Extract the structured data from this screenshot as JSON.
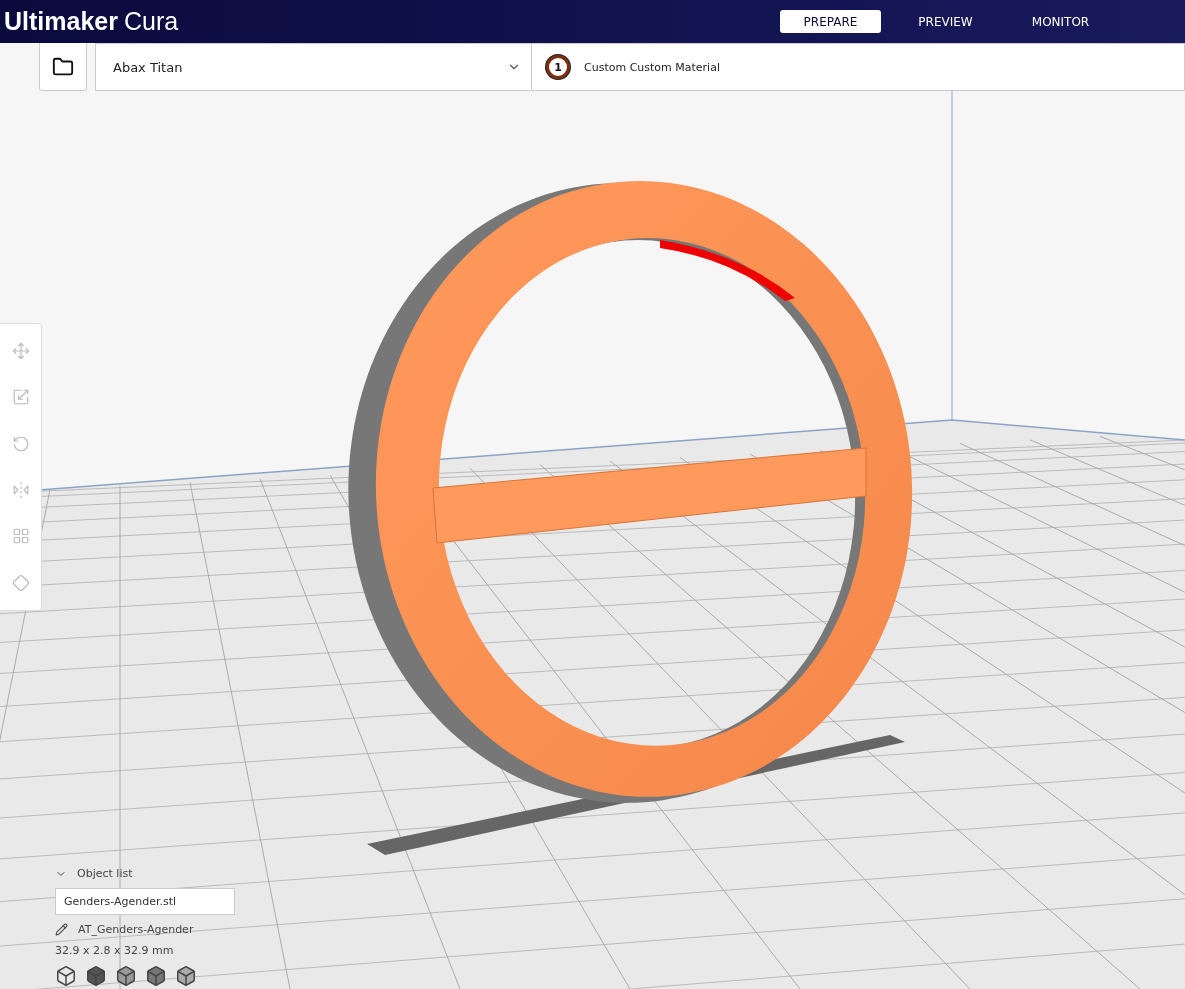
{
  "app": {
    "title_bold": "Ultimaker",
    "title_light": "Cura"
  },
  "stages": [
    {
      "label": "PREPARE",
      "selected": true
    },
    {
      "label": "PREVIEW",
      "selected": false
    },
    {
      "label": "MONITOR",
      "selected": false
    }
  ],
  "printer": {
    "name": "Abax Titan"
  },
  "extruders": [
    {
      "number": "1",
      "material": "Custom Custom Material"
    }
  ],
  "tools": [
    {
      "kind": "move"
    },
    {
      "kind": "scale"
    },
    {
      "kind": "rotate"
    },
    {
      "kind": "mirror"
    },
    {
      "kind": "per-model"
    },
    {
      "kind": "support-blocker"
    }
  ],
  "object_list": {
    "title": "Object list",
    "expanded": true,
    "objects": [
      "Genders-Agender.stl"
    ],
    "job_name": "AT_Genders-Agender",
    "dimensions": "32.9 x 2.8 x 32.9 mm"
  },
  "view_buttons": [
    {
      "kind": "perspective"
    },
    {
      "kind": "front"
    },
    {
      "kind": "top"
    },
    {
      "kind": "left"
    },
    {
      "kind": "right"
    }
  ]
}
